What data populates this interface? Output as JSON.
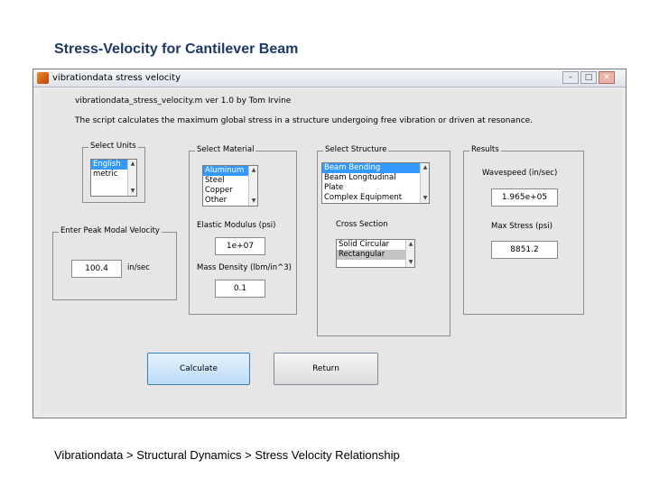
{
  "slide": {
    "title": "Stress-Velocity for Cantilever Beam",
    "footer": "Vibrationdata > Structural Dynamics > Stress Velocity Relationship"
  },
  "window": {
    "title": "vibrationdata stress velocity",
    "controls": {
      "minimize": "–",
      "maximize": "□",
      "close": "✕"
    }
  },
  "header": {
    "version_line": "vibrationdata_stress_velocity.m  ver 1.0  by Tom Irvine",
    "description": "The script calculates the maximum global stress in a structure undergoing free vibration or driven at resonance."
  },
  "units": {
    "label": "Select Units",
    "options": [
      "English",
      "metric"
    ],
    "selected_index": 0
  },
  "peak_velocity": {
    "label": "Enter Peak Modal Velocity",
    "value": "100.4",
    "unit": "in/sec"
  },
  "material": {
    "label": "Select Material",
    "options": [
      "Aluminum",
      "Steel",
      "Copper",
      "Other"
    ],
    "selected_index": 0,
    "elastic_modulus_label": "Elastic Modulus (psi)",
    "elastic_modulus_value": "1e+07",
    "mass_density_label": "Mass Density (lbm/in^3)",
    "mass_density_value": "0.1"
  },
  "structure": {
    "label": "Select Structure",
    "options": [
      "Beam Bending",
      "Beam Longitudinal",
      "Plate",
      "Complex Equipment"
    ],
    "selected_index": 0,
    "cross_section_label": "Cross Section",
    "cross_section_options": [
      "Solid Circular",
      "Rectangular"
    ],
    "cross_section_selected_index": 1
  },
  "results": {
    "label": "Results",
    "wavespeed_label": "Wavespeed (in/sec)",
    "wavespeed_value": "1.965e+05",
    "max_stress_label": "Max Stress (psi)",
    "max_stress_value": "8851.2"
  },
  "buttons": {
    "calculate": "Calculate",
    "return": "Return"
  },
  "colors": {
    "selection": "#3399ff",
    "slide_title": "#1f3864",
    "calculate_button": "#cfe6fa"
  }
}
